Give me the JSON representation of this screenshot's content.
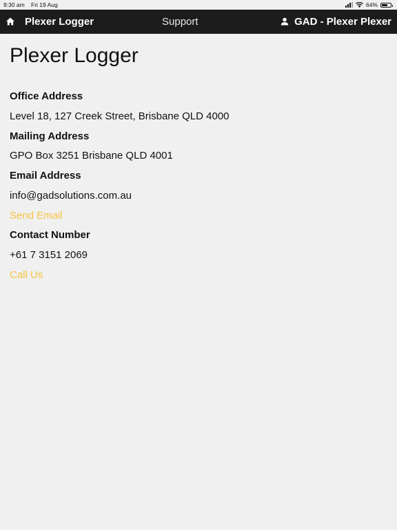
{
  "status_bar": {
    "time": "9:30 am",
    "date": "Fri 19 Aug",
    "battery": "64%",
    "battery_level": 0.64
  },
  "navbar": {
    "brand": "Plexer Logger",
    "support": "Support",
    "user": "GAD - Plexer Plexer"
  },
  "page": {
    "title": "Plexer Logger",
    "office_label": "Office Address",
    "office_value": "Level 18, 127 Creek Street, Brisbane QLD 4000",
    "mailing_label": "Mailing Address",
    "mailing_value": "GPO Box 3251 Brisbane QLD 4001",
    "email_label": "Email Address",
    "email_value": "info@gadsolutions.com.au",
    "send_email": "Send Email",
    "contact_label": "Contact Number",
    "contact_value": "+61 7 3151 2069",
    "call_us": "Call Us"
  },
  "colors": {
    "navbar_bg": "#1c1c1c",
    "link": "#f6c344",
    "page_bg": "#f0f0f0"
  }
}
